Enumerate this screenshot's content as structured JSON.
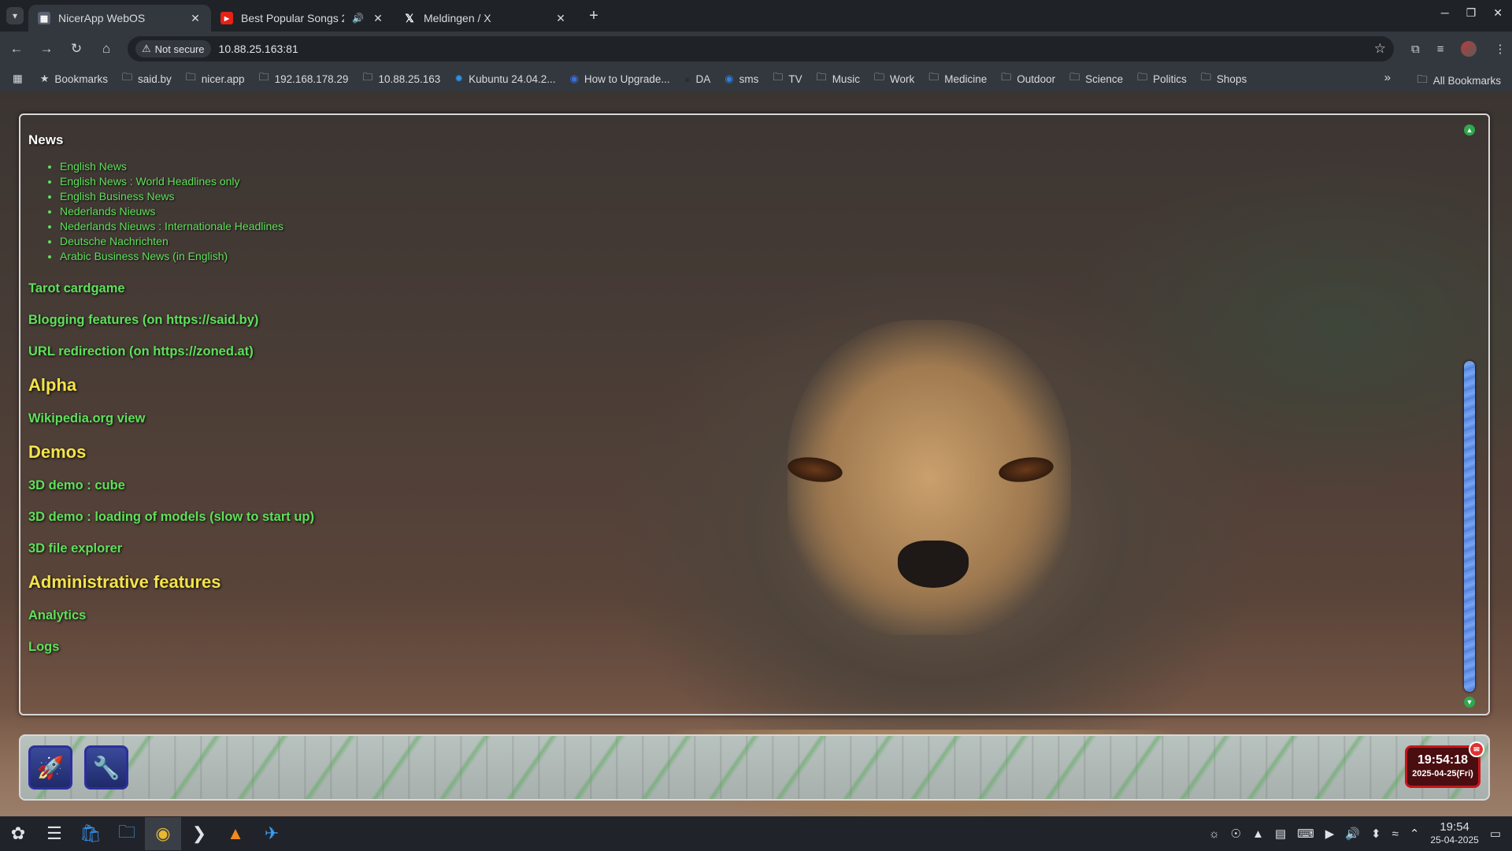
{
  "browser": {
    "tabs": [
      {
        "title": "NicerApp WebOS",
        "icon": "nicerapp-icon",
        "active": true,
        "audio": false
      },
      {
        "title": "Best Popular Songs 202",
        "icon": "youtube-icon",
        "active": false,
        "audio": true
      },
      {
        "title": "Meldingen / X",
        "icon": "x-icon",
        "active": false,
        "audio": false
      }
    ],
    "security_label": "Not secure",
    "url": "10.88.25.163:81",
    "bookmarks": [
      {
        "label": "Bookmarks",
        "icon": "star-icon"
      },
      {
        "label": "said.by",
        "icon": "folder-icon"
      },
      {
        "label": "nicer.app",
        "icon": "folder-icon"
      },
      {
        "label": "192.168.178.29",
        "icon": "folder-icon"
      },
      {
        "label": "10.88.25.163",
        "icon": "folder-icon"
      },
      {
        "label": "Kubuntu 24.04.2...",
        "icon": "kubuntu-icon"
      },
      {
        "label": "How to Upgrade...",
        "icon": "page-icon"
      },
      {
        "label": "DA",
        "icon": "deviantart-icon"
      },
      {
        "label": "sms",
        "icon": "chat-icon"
      },
      {
        "label": "TV",
        "icon": "folder-icon"
      },
      {
        "label": "Music",
        "icon": "folder-icon"
      },
      {
        "label": "Work",
        "icon": "folder-icon"
      },
      {
        "label": "Medicine",
        "icon": "folder-icon"
      },
      {
        "label": "Outdoor",
        "icon": "folder-icon"
      },
      {
        "label": "Science",
        "icon": "folder-icon"
      },
      {
        "label": "Politics",
        "icon": "folder-icon"
      },
      {
        "label": "Shops",
        "icon": "folder-icon"
      }
    ],
    "all_bookmarks_label": "All Bookmarks"
  },
  "page": {
    "news_heading": "News",
    "news_items": [
      "English News",
      "English News : World Headlines only",
      "English Business News",
      "Nederlands Nieuws",
      "Nederlands Nieuws : Internationale Headlines",
      "Deutsche Nachrichten",
      "Arabic Business News (in English)"
    ],
    "links_1": {
      "tarot": "Tarot cardgame",
      "blogging": "Blogging features (on https://said.by)",
      "redirect": "URL redirection (on https://zoned.at)"
    },
    "alpha_heading": "Alpha",
    "alpha_link": "Wikipedia.org view",
    "demos_heading": "Demos",
    "demo_links": {
      "cube": "3D demo : cube",
      "models": "3D demo : loading of models (slow to start up)",
      "explorer": "3D file explorer"
    },
    "admin_heading": "Administrative features",
    "admin_links": {
      "analytics": "Analytics",
      "logs": "Logs"
    }
  },
  "webos_bar": {
    "clock_time": "19:54:18",
    "clock_date": "2025-04-25(Fri)"
  },
  "taskbar": {
    "time": "19:54",
    "date": "25-04-2025"
  },
  "colors": {
    "link_green": "#5ee05a",
    "heading_yellow": "#f4e34a",
    "clock_red": "#c4161c",
    "scroll_blue": "#5a8ce8"
  }
}
